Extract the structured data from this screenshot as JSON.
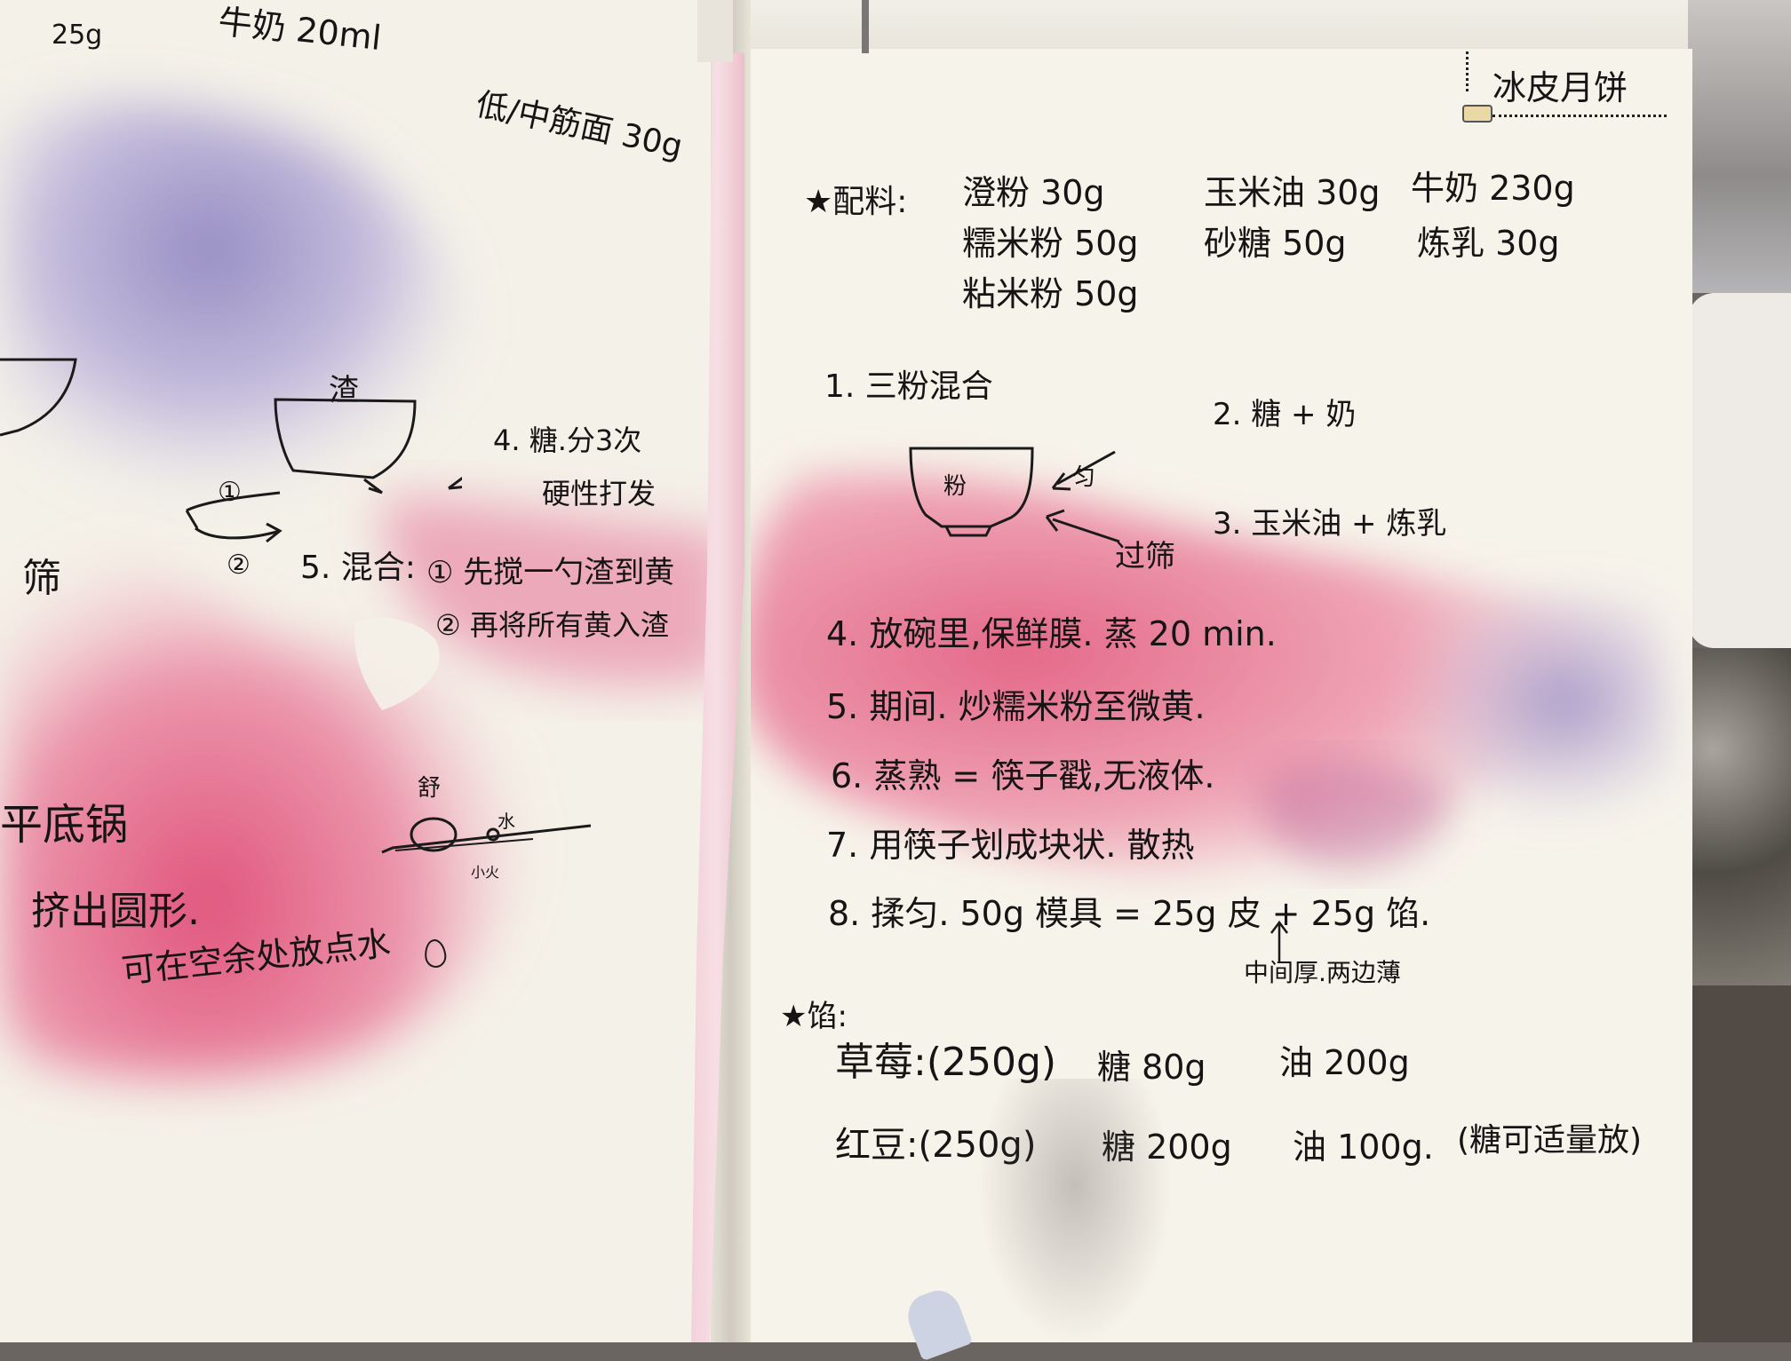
{
  "left_page": {
    "top_line_1": "25g",
    "top_line_2": "牛奶 20ml",
    "top_line_3": "低/中筋面 30g",
    "bowl_label": "渣",
    "step_4a": "4. 糖.分3次",
    "step_4b": "硬性打发",
    "circle_1": "①",
    "circle_2": "②",
    "step_5_label": "5. 混合:",
    "step_5a": "① 先搅一勺渣到黄",
    "step_5b": "② 再将所有黄入渣",
    "sieve_fragment": "筛",
    "diagram_label_top": "舒",
    "diagram_label_water": "水",
    "diagram_label_heat": "小火",
    "pan_fragment": "平底锅",
    "circle_fragment": "挤出圆形.",
    "bottom_fragment": "可在空余处放点水"
  },
  "right_page": {
    "title": "冰皮月饼",
    "ingredients": {
      "heading": "★配料:",
      "items": [
        "澄粉 30g",
        "玉米油 30g",
        "牛奶 230g",
        "糯米粉 50g",
        "砂糖 50g",
        "炼乳 30g",
        "粘米粉 50g"
      ]
    },
    "steps": {
      "s1": "1. 三粉混合",
      "s2": "2. 糖 + 奶",
      "bowl_text": "粉",
      "stir_text": "匀",
      "s3": "3. 玉米油 + 炼乳",
      "sieve": "过筛",
      "s4": "4. 放碗里,保鲜膜. 蒸 20 min.",
      "s5": "5. 期间. 炒糯米粉至微黄.",
      "s6": "6. 蒸熟 = 筷子戳,无液体.",
      "s7": "7. 用筷子划成块状. 散热",
      "s8": "8. 揉匀. 50g 模具 = 25g 皮 + 25g 馅.",
      "s8_note": "中间厚.两边薄"
    },
    "filling": {
      "heading": "★馅:",
      "row1": [
        "草莓:(250g)",
        "糖 80g",
        "油 200g"
      ],
      "row2": [
        "红豆:(250g)",
        "糖 200g",
        "油 100g.",
        "(糖可适量放)"
      ]
    }
  },
  "colors": {
    "paper": "#f6f3ea",
    "ink": "#161414",
    "pink_wash": "#e56f8e",
    "lilac_wash": "#b9a7cf",
    "ribbon": "#f2c9d2",
    "background": "#6a6560"
  }
}
